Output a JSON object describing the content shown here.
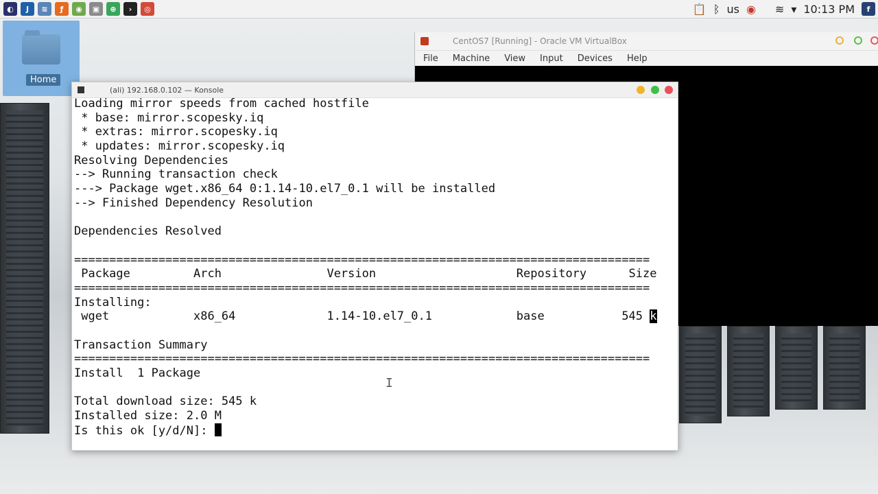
{
  "top_panel": {
    "launchers": [
      {
        "icon": "eclipse-icon",
        "color": "#2b2f6a",
        "glyph": "◐"
      },
      {
        "icon": "intellij-icon",
        "color": "#1f5fa8",
        "glyph": "J"
      },
      {
        "icon": "network-icon",
        "color": "#5b86b5",
        "glyph": "≋"
      },
      {
        "icon": "firefox-icon",
        "color": "#e66a1f",
        "glyph": "ƒ"
      },
      {
        "icon": "android-studio-icon",
        "color": "#6fa94d",
        "glyph": "◉"
      },
      {
        "icon": "screenshot-icon",
        "color": "#8a8a8a",
        "glyph": "▣"
      },
      {
        "icon": "evince-icon",
        "color": "#3aa55c",
        "glyph": "⊕"
      },
      {
        "icon": "terminal-icon",
        "color": "#222",
        "glyph": "›"
      },
      {
        "icon": "chrome-icon",
        "color": "#d34a3b",
        "glyph": "◎"
      }
    ],
    "keyboard_layout": "us",
    "clock": "10:13 PM"
  },
  "desktop": {
    "home_label": "Home"
  },
  "virtualbox": {
    "title": "CentOS7 [Running] - Oracle VM VirtualBox",
    "menu": [
      "File",
      "Machine",
      "View",
      "Input",
      "Devices",
      "Help"
    ]
  },
  "konsole": {
    "title": "(ali) 192.168.0.102 — Konsole",
    "lines": [
      "Loading mirror speeds from cached hostfile",
      " * base: mirror.scopesky.iq",
      " * extras: mirror.scopesky.iq",
      " * updates: mirror.scopesky.iq",
      "Resolving Dependencies",
      "--> Running transaction check",
      "---> Package wget.x86_64 0:1.14-10.el7_0.1 will be installed",
      "--> Finished Dependency Resolution",
      "",
      "Dependencies Resolved",
      "",
      "==================================================================================",
      " Package         Arch               Version                    Repository      Size",
      "==================================================================================",
      "Installing:",
      " wget            x86_64             1.14-10.el7_0.1            base           545 ",
      "",
      "Transaction Summary",
      "==================================================================================",
      "Install  1 Package",
      "",
      "Total download size: 545 k",
      "Installed size: 2.0 M",
      "Is this ok [y/d/N]: "
    ],
    "selected_char": "k",
    "text_cursor": "I"
  }
}
